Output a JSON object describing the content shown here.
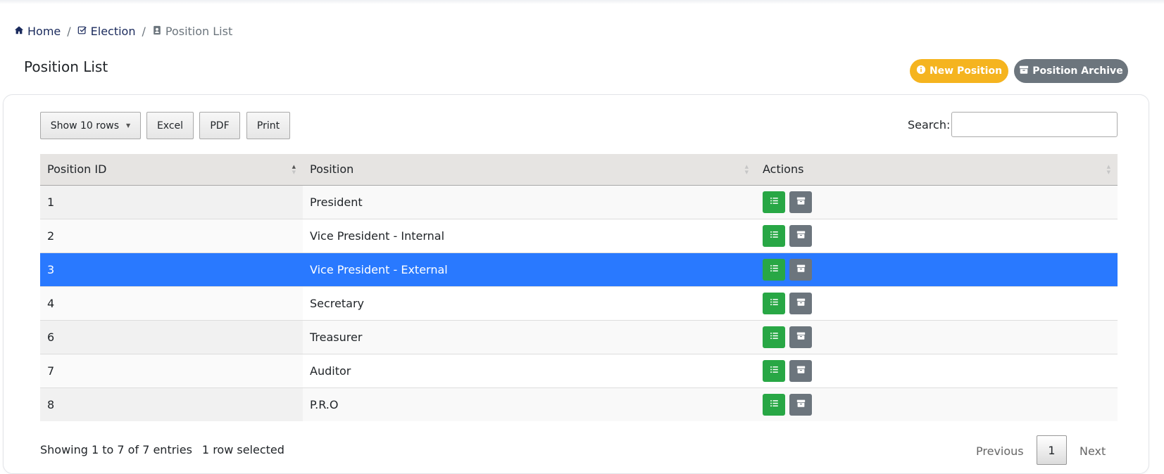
{
  "breadcrumb": {
    "home": "Home",
    "election": "Election",
    "current": "Position List"
  },
  "page": {
    "title": "Position List",
    "new_button": "New Position",
    "archive_button": "Position Archive"
  },
  "toolbar": {
    "show_rows": "Show 10 rows",
    "excel": "Excel",
    "pdf": "PDF",
    "print": "Print",
    "search_label": "Search:",
    "search_value": ""
  },
  "table": {
    "columns": [
      "Position ID",
      "Position",
      "Actions"
    ],
    "rows": [
      {
        "id": "1",
        "position": "President",
        "selected": false
      },
      {
        "id": "2",
        "position": "Vice President - Internal",
        "selected": false
      },
      {
        "id": "3",
        "position": "Vice President - External",
        "selected": true
      },
      {
        "id": "4",
        "position": "Secretary",
        "selected": false
      },
      {
        "id": "6",
        "position": "Treasurer",
        "selected": false
      },
      {
        "id": "7",
        "position": "Auditor",
        "selected": false
      },
      {
        "id": "8",
        "position": "P.R.O",
        "selected": false
      }
    ]
  },
  "footer": {
    "info": "Showing 1 to 7 of 7 entries",
    "selected_info": "1 row selected",
    "previous": "Previous",
    "page": "1",
    "next": "Next"
  },
  "colors": {
    "brand_navy": "#1a2a5c",
    "warning": "#f5b41f",
    "secondary": "#6c757d",
    "success": "#28a745",
    "selected_row": "#2979ff"
  }
}
